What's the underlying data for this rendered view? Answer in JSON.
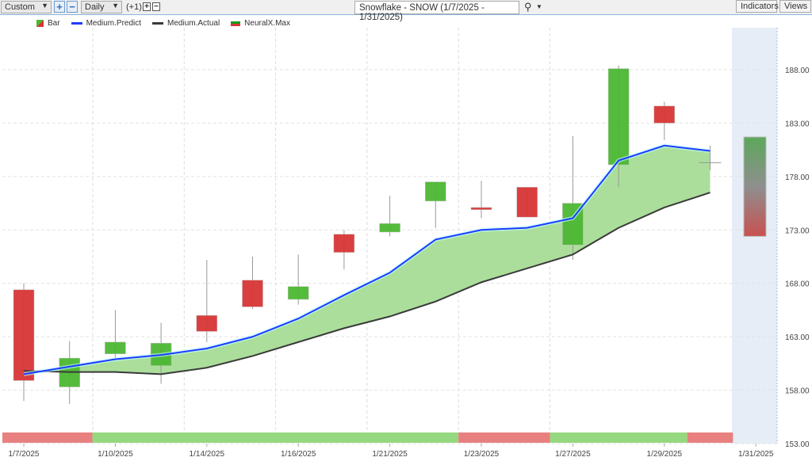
{
  "toolbar": {
    "range": "Custom",
    "interval": "Daily",
    "offset": "(+1)",
    "title": "Snowflake - SNOW (1/7/2025 - 1/31/2025)",
    "indicators": "Indicators",
    "views": "Views"
  },
  "legend": [
    {
      "label": "Bar"
    },
    {
      "label": "Medium.Predict"
    },
    {
      "label": "Medium.Actual"
    },
    {
      "label": "NeuralX.Max"
    }
  ],
  "colors": {
    "up": "#4cb832",
    "down": "#d93535",
    "predict": "#1f3cff",
    "actual": "#3a3a3a",
    "fill": "#a6dc96",
    "barRed": "#e88080",
    "barGreen": "#96d880"
  },
  "chart_data": {
    "type": "candlestick",
    "title": "Snowflake - SNOW (1/7/2025 - 1/31/2025)",
    "ylim": [
      153,
      190
    ],
    "yticks": [
      "188.00",
      "183.00",
      "178.00",
      "173.00",
      "168.00",
      "163.00",
      "158.00",
      "153.00"
    ],
    "ytick_values": [
      188,
      183,
      178,
      173,
      168,
      163,
      158,
      153
    ],
    "xtick_labels": [
      {
        "i": 0,
        "label": "1/7/2025"
      },
      {
        "i": 2,
        "label": "1/10/2025"
      },
      {
        "i": 4,
        "label": "1/14/2025"
      },
      {
        "i": 6,
        "label": "1/16/2025"
      },
      {
        "i": 8,
        "label": "1/21/2025"
      },
      {
        "i": 10,
        "label": "1/23/2025"
      },
      {
        "i": 12,
        "label": "1/27/2025"
      },
      {
        "i": 14,
        "label": "1/29/2025"
      },
      {
        "i": 16,
        "label": "1/31/2025"
      }
    ],
    "candles": [
      {
        "o": 167.4,
        "h": 168.0,
        "l": 157.0,
        "c": 158.9
      },
      {
        "o": 158.3,
        "h": 162.6,
        "l": 156.7,
        "c": 161.0
      },
      {
        "o": 161.4,
        "h": 165.5,
        "l": 160.8,
        "c": 162.5
      },
      {
        "o": 160.3,
        "h": 164.3,
        "l": 158.6,
        "c": 162.4
      },
      {
        "o": 165.0,
        "h": 170.2,
        "l": 162.5,
        "c": 163.5
      },
      {
        "o": 168.3,
        "h": 170.5,
        "l": 165.6,
        "c": 165.8
      },
      {
        "o": 166.5,
        "h": 170.7,
        "l": 166.0,
        "c": 167.7
      },
      {
        "o": 172.6,
        "h": 173.0,
        "l": 169.3,
        "c": 170.9
      },
      {
        "o": 172.8,
        "h": 176.2,
        "l": 172.4,
        "c": 173.6
      },
      {
        "o": 175.7,
        "h": 177.5,
        "l": 173.2,
        "c": 177.5
      },
      {
        "o": 175.1,
        "h": 177.6,
        "l": 174.1,
        "c": 174.9
      },
      {
        "o": 177.0,
        "h": 177.0,
        "l": 174.2,
        "c": 174.2
      },
      {
        "o": 171.6,
        "h": 181.8,
        "l": 170.2,
        "c": 175.5
      },
      {
        "o": 179.1,
        "h": 188.4,
        "l": 177.0,
        "c": 188.1
      },
      {
        "o": 184.6,
        "h": 185.0,
        "l": 181.4,
        "c": 183.0
      },
      {
        "o": 179.3,
        "h": 180.9,
        "l": 178.6,
        "c": 179.3
      }
    ],
    "series": [
      {
        "name": "Medium.Predict",
        "values": [
          159.5,
          160.2,
          160.9,
          161.3,
          161.9,
          163.0,
          164.7,
          166.9,
          169.0,
          172.1,
          173.0,
          173.2,
          174.1,
          179.5,
          180.9,
          180.4
        ]
      },
      {
        "name": "Medium.Actual",
        "values": [
          159.8,
          159.7,
          159.7,
          159.5,
          160.1,
          161.2,
          162.5,
          163.8,
          164.9,
          166.3,
          168.1,
          169.4,
          170.7,
          173.2,
          175.1,
          176.5
        ]
      }
    ],
    "forecast_range": {
      "high": 181.7,
      "low": 172.4
    },
    "neuralx_bar": [
      {
        "from": 0,
        "to": 2,
        "signal": "down"
      },
      {
        "from": 2,
        "to": 10,
        "signal": "up"
      },
      {
        "from": 10,
        "to": 12,
        "signal": "down"
      },
      {
        "from": 12,
        "to": 15,
        "signal": "up"
      },
      {
        "from": 15,
        "to": 16,
        "signal": "down"
      }
    ]
  }
}
